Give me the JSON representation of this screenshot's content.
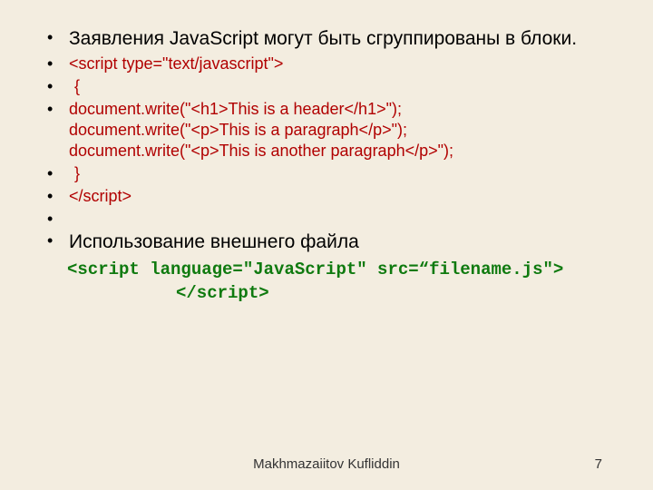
{
  "bullets": {
    "b1": "Заявления JavaScript могут быть сгруппированы в блоки.",
    "b2": "<script type=\"text/javascript\">",
    "b3": " {",
    "b4_l1": "document.write(\"<h1>This is a header</h1>\");",
    "b4_l2": "document.write(\"<p>This is a paragraph</p>\");",
    "b4_l3": "document.write(\"<p>This is another paragraph</p>\");",
    "b5": " }",
    "b6": "</script>",
    "b7": "Использование внешнего файла"
  },
  "green": {
    "l1": "<script language=\"JavaScript\" src=“filename.js\">",
    "l2": "</script>"
  },
  "footer": {
    "author": "Makhmazaiitov Kufliddin",
    "page": "7"
  }
}
